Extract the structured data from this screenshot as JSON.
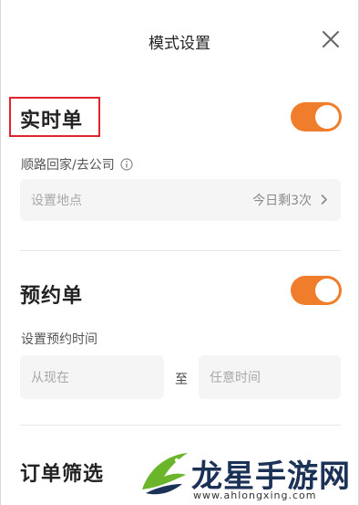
{
  "header": {
    "title": "模式设置"
  },
  "realtime": {
    "title": "实时单",
    "toggle_on": true,
    "route_label": "顺路回家/去公司",
    "location_placeholder": "设置地点",
    "remaining_text": "今日剩3次"
  },
  "reservation": {
    "title": "预约单",
    "toggle_on": true,
    "time_label": "设置预约时间",
    "from_placeholder": "从现在",
    "to_text": "至",
    "to_placeholder": "任意时间"
  },
  "filter": {
    "title": "订单筛选"
  },
  "watermark": {
    "text": "龙星手游网",
    "url": "www.ahlongxing.com"
  },
  "colors": {
    "accent": "#f07d2c",
    "highlight": "#e0242d"
  }
}
